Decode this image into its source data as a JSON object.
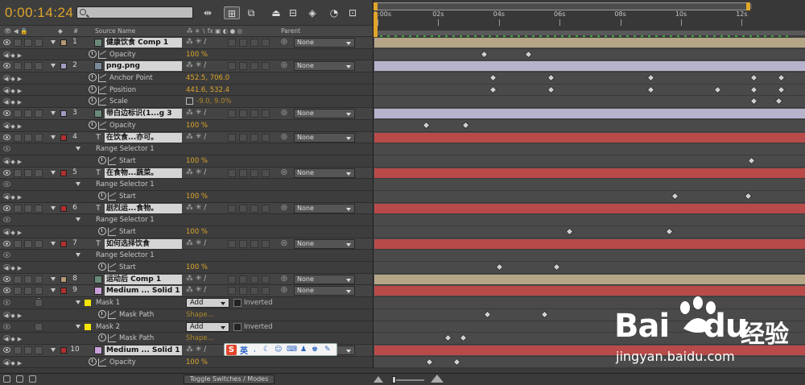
{
  "header": {
    "timecode": "0:00:14:24",
    "search_placeholder": "",
    "toolbar_icons": [
      "comp-mini-flowchart-icon",
      "draft-3d-icon",
      "shy-layers-icon",
      "frame-blending-icon",
      "motion-blur-icon",
      "brainstorm-icon",
      "auto-keyframe-icon",
      "graph-editor-icon"
    ]
  },
  "columns": {
    "hash": "#",
    "source_name": "Source Name",
    "parent": "Parent"
  },
  "ruler": {
    "labels": [
      "0:00s",
      "02s",
      "04s",
      "06s",
      "08s",
      "10s",
      "12s"
    ]
  },
  "rows": [
    {
      "kind": "layer",
      "num": "1",
      "type": "comp",
      "label_color": "#b59a78",
      "name": "健康饮食 Comp 1",
      "parent": "None",
      "bar": "tan",
      "swatch": "#b59a78"
    },
    {
      "kind": "prop",
      "indent": 1,
      "name": "Opacity",
      "value": "100 %",
      "stopwatch": true,
      "keyframes": [
        3.5,
        4.95
      ]
    },
    {
      "kind": "layer",
      "num": "2",
      "type": "footage",
      "label_color": "#a39ac2",
      "name": "png.png",
      "parent": "None",
      "bar": "lav",
      "swatch": "#a39ac2"
    },
    {
      "kind": "prop",
      "indent": 1,
      "name": "Anchor Point",
      "value": "452.5, 706.0",
      "stopwatch": true,
      "keyframes": [
        3.8,
        5.7,
        9.0,
        12.4,
        13.3
      ]
    },
    {
      "kind": "prop",
      "indent": 1,
      "name": "Position",
      "value": "441.6, 532.4",
      "stopwatch": true,
      "keyframes": [
        3.8,
        5.7,
        9.0,
        11.2,
        12.4,
        13.3
      ]
    },
    {
      "kind": "prop",
      "indent": 1,
      "name": "Scale",
      "value": "-9.0, 9.0%",
      "stopwatch": true,
      "link": true,
      "keyframes": [
        12.4,
        13.2
      ]
    },
    {
      "kind": "layer",
      "num": "3",
      "type": "comp",
      "label_color": "#a39ac2",
      "name": "带白边标识(1...g 3",
      "parent": "None",
      "bar": "lav",
      "swatch": "#a39ac2"
    },
    {
      "kind": "prop",
      "indent": 1,
      "name": "Opacity",
      "value": "100 %",
      "stopwatch": true,
      "keyframes": [
        1.6,
        2.9
      ]
    },
    {
      "kind": "layer",
      "num": "4",
      "type": "text",
      "label_color": "#b03030",
      "name": "在饮食...亦可。",
      "parent": "None",
      "bar": "red",
      "swatch": "#b03030"
    },
    {
      "kind": "group",
      "indent": 1,
      "name": "Range Selector 1"
    },
    {
      "kind": "prop",
      "indent": 2,
      "name": "Start",
      "value": "100 %",
      "stopwatch": true,
      "keyframes": [
        12.3
      ]
    },
    {
      "kind": "layer",
      "num": "5",
      "type": "text",
      "label_color": "#b03030",
      "name": "在食物...蔬菜。",
      "parent": "None",
      "bar": "red",
      "swatch": "#b03030"
    },
    {
      "kind": "group",
      "indent": 1,
      "name": "Range Selector 1"
    },
    {
      "kind": "prop",
      "indent": 2,
      "name": "Start",
      "value": "100 %",
      "stopwatch": true,
      "keyframes": [
        9.8,
        12.2
      ]
    },
    {
      "kind": "layer",
      "num": "6",
      "type": "text",
      "label_color": "#b03030",
      "name": "剧烈运...食物。",
      "parent": "None",
      "bar": "red",
      "swatch": "#b03030"
    },
    {
      "kind": "group",
      "indent": 1,
      "name": "Range Selector 1"
    },
    {
      "kind": "prop",
      "indent": 2,
      "name": "Start",
      "value": "100 %",
      "stopwatch": true,
      "keyframes": [
        6.3,
        9.6
      ]
    },
    {
      "kind": "layer",
      "num": "7",
      "type": "text",
      "label_color": "#b03030",
      "name": "如何选择饮食",
      "parent": "None",
      "bar": "red",
      "swatch": "#b03030"
    },
    {
      "kind": "group",
      "indent": 1,
      "name": "Range Selector 1"
    },
    {
      "kind": "prop",
      "indent": 2,
      "name": "Start",
      "value": "100 %",
      "stopwatch": true,
      "keyframes": [
        4.0,
        5.9
      ]
    },
    {
      "kind": "layer",
      "num": "8",
      "type": "comp",
      "label_color": "#b59a78",
      "name": "运动后 Comp 1",
      "parent": "None",
      "bar": "tan",
      "swatch": "#b59a78"
    },
    {
      "kind": "layer",
      "num": "9",
      "type": "solid",
      "label_color": "#b03030",
      "name": "Medium ... Solid 1",
      "parent": "None",
      "bar": "red",
      "swatch": "#b03030"
    },
    {
      "kind": "mask",
      "indent": 1,
      "name": "Mask 1",
      "mode": "Add",
      "inverted": "Inverted",
      "locked": true
    },
    {
      "kind": "prop",
      "indent": 2,
      "name": "Mask Path",
      "value": "Shape...",
      "stopwatch": true,
      "link": true,
      "keyframes": [
        3.6,
        5.5
      ]
    },
    {
      "kind": "mask",
      "indent": 1,
      "name": "Mask 2",
      "mode": "Add",
      "inverted": "Inverted",
      "locked": false
    },
    {
      "kind": "prop",
      "indent": 2,
      "name": "Mask Path",
      "value": "Shape...",
      "stopwatch": true,
      "link": true,
      "keyframes": [
        2.3,
        2.8
      ]
    },
    {
      "kind": "layer",
      "num": "10",
      "type": "solid",
      "label_color": "#b03030",
      "name": "Medium ... Solid 1",
      "parent": "None",
      "bar": "red",
      "swatch": "#b03030"
    },
    {
      "kind": "prop",
      "indent": 1,
      "name": "Opacity",
      "value": "100 %",
      "stopwatch": true,
      "keyframes": [
        1.7,
        2.6
      ]
    }
  ],
  "bottom": {
    "toggle_label": "Toggle Switches / Modes"
  },
  "ime": {
    "logo": "S",
    "mode": "英"
  },
  "watermark": {
    "brand_left": "Bai",
    "brand_right": "du",
    "cn": "经验",
    "url": "jingyan.baidu.com"
  }
}
